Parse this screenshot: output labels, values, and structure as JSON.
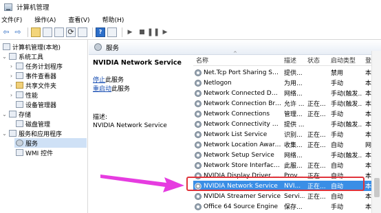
{
  "window": {
    "title": "计算机管理"
  },
  "menu": [
    "文件(F)",
    "操作(A)",
    "查看(V)",
    "帮助(H)"
  ],
  "toolbar": {
    "icons": [
      "back-arrow-icon",
      "forward-arrow-icon",
      "up-folder-icon",
      "console-tree-icon",
      "copy-icon",
      "refresh-icon",
      "export-list-icon",
      "help-icon",
      "properties-icon",
      "start-service-icon",
      "stop-service-icon",
      "pause-service-icon",
      "restart-service-icon"
    ]
  },
  "tree": {
    "root": "计算机管理(本地)",
    "system_tools": "系统工具",
    "task_scheduler": "任务计划程序",
    "event_viewer": "事件查看器",
    "shared_folders": "共享文件夹",
    "performance": "性能",
    "device_manager": "设备管理器",
    "storage": "存储",
    "disk_management": "磁盘管理",
    "services_apps": "服务和应用程序",
    "services": "服务",
    "wmi": "WMI 控件"
  },
  "content": {
    "header_title": "服务",
    "detail": {
      "service_name": "NVIDIA Network Service",
      "stop_link": "停止",
      "stop_suffix": "此服务",
      "restart_link": "重启动",
      "restart_suffix": "此服务",
      "desc_label": "描述:",
      "desc_text": "NVIDIA Network Service"
    },
    "columns": {
      "name": "名称",
      "desc": "描述",
      "status": "状态",
      "startup": "启动类型",
      "logon": "登"
    },
    "services": [
      {
        "name": "Net.Tcp Port Sharing Ser...",
        "desc": "提供...",
        "status": "",
        "startup": "禁用",
        "logon": "本"
      },
      {
        "name": "Netlogon",
        "desc": "为用...",
        "status": "",
        "startup": "手动",
        "logon": "本"
      },
      {
        "name": "Network Connected Devi...",
        "desc": "网络...",
        "status": "",
        "startup": "手动(触发...",
        "logon": "本"
      },
      {
        "name": "Network Connection Bro...",
        "desc": "允许 ...",
        "status": "正在...",
        "startup": "手动(触发...",
        "logon": "本"
      },
      {
        "name": "Network Connections",
        "desc": "管理...",
        "status": "正在...",
        "startup": "手动",
        "logon": "本"
      },
      {
        "name": "Network Connectivity Ass...",
        "desc": "提供 ...",
        "status": "",
        "startup": "手动(触发...",
        "logon": "本"
      },
      {
        "name": "Network List Service",
        "desc": "识别...",
        "status": "正在...",
        "startup": "手动",
        "logon": "本"
      },
      {
        "name": "Network Location Aware...",
        "desc": "收集...",
        "status": "正在...",
        "startup": "自动",
        "logon": "网"
      },
      {
        "name": "Network Setup Service",
        "desc": "网络...",
        "status": "",
        "startup": "手动(触发...",
        "logon": "本"
      },
      {
        "name": "Network Store Interface ...",
        "desc": "此服...",
        "status": "正在...",
        "startup": "自动",
        "logon": "本"
      },
      {
        "name": "NVIDIA Display Driver Se...",
        "desc": "Prov...",
        "status": "正在...",
        "startup": "自动",
        "logon": "本"
      },
      {
        "name": "NVIDIA Network Service",
        "desc": "NVI...",
        "status": "正在...",
        "startup": "自动",
        "logon": "本"
      },
      {
        "name": "NVIDIA Streamer Service",
        "desc": "Servi...",
        "status": "正在...",
        "startup": "自动",
        "logon": "本"
      },
      {
        "name": "Office 64 Source Engine",
        "desc": "保存...",
        "status": "",
        "startup": "手动",
        "logon": "本"
      }
    ]
  },
  "colors": {
    "selection": "#3a8ee6",
    "annotation_box": "#e0333a",
    "annotation_arrow": "#e63ce0",
    "link": "#1a4fb3"
  }
}
